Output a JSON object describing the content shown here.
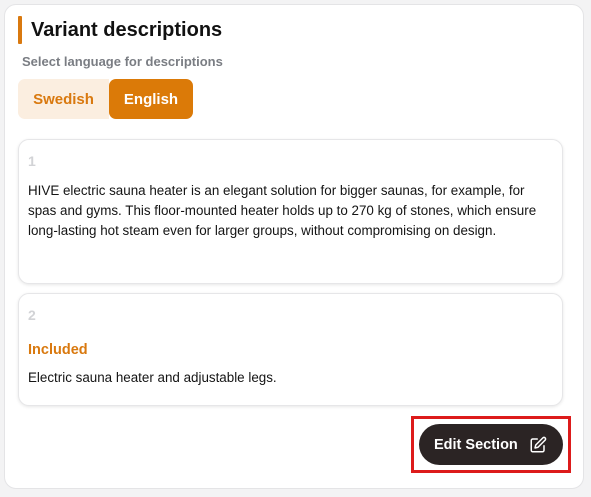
{
  "section": {
    "title": "Variant descriptions",
    "subtitle": "Select language for descriptions",
    "accent_color": "#d9790f"
  },
  "languages": {
    "options": [
      "Swedish",
      "English"
    ],
    "selected": "English"
  },
  "descriptions": [
    {
      "number": "1",
      "heading": "",
      "text": "HIVE electric sauna heater is an elegant solution for bigger saunas, for example, for spas and gyms. This floor-mounted heater holds up to 270 kg of stones, which ensure long-lasting hot steam even for larger groups, without compromising on design."
    },
    {
      "number": "2",
      "heading": "Included",
      "text": "Electric sauna heater and adjustable legs."
    }
  ],
  "actions": {
    "edit_label": "Edit Section",
    "edit_icon": "pencil-square-icon",
    "highlight_color": "#dd1b1b"
  }
}
